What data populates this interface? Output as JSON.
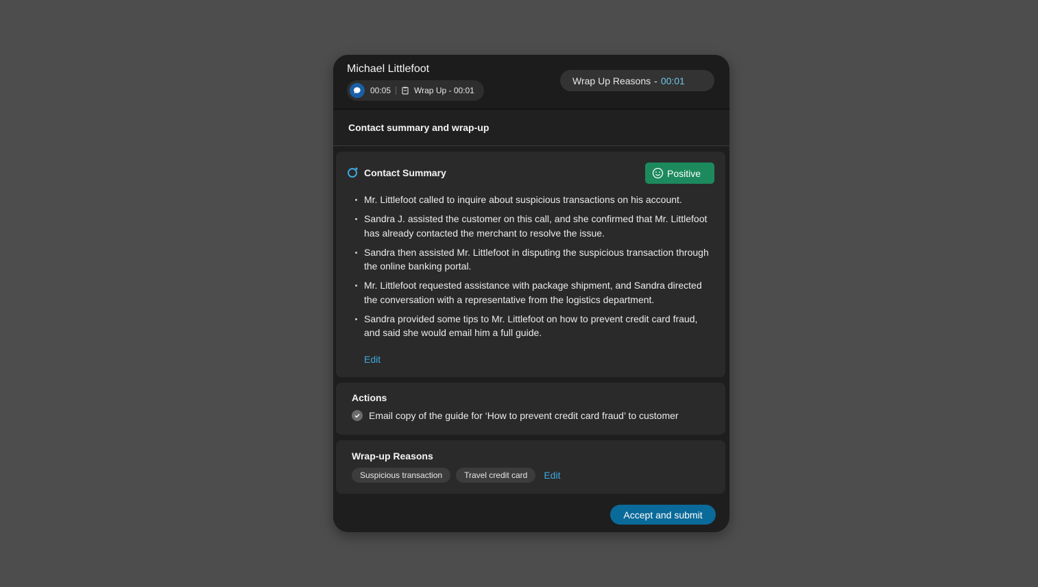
{
  "header": {
    "customer_name": "Michael Littlefoot",
    "call_timer": "00:05",
    "wrap_up_label": "Wrap Up - 00:01",
    "reasons_label": "Wrap Up Reasons",
    "reasons_dash": "-",
    "reasons_timer": "00:01"
  },
  "section": {
    "title": "Contact summary and wrap-up"
  },
  "summary": {
    "title": "Contact Summary",
    "sentiment": "Positive",
    "bullets": [
      "Mr. Littlefoot called to inquire about suspicious transactions on his account.",
      "Sandra J. assisted the customer on this call, and she confirmed that Mr. Littlefoot has already contacted the merchant to resolve the issue.",
      "Sandra then assisted Mr. Littlefoot in disputing the suspicious transaction through the online banking portal.",
      "Mr. Littlefoot requested assistance with package shipment, and Sandra directed the conversation with a representative from the logistics department.",
      "Sandra provided some tips to Mr. Littlefoot on how to prevent credit card fraud, and said she would email him a full guide."
    ],
    "edit_label": "Edit"
  },
  "actions": {
    "title": "Actions",
    "items": [
      "Email copy of the guide for ‘How to prevent credit card fraud’ to customer"
    ]
  },
  "wrapup_reasons": {
    "title": "Wrap-up Reasons",
    "chips": [
      "Suspicious transaction",
      "Travel credit card"
    ],
    "edit_label": "Edit"
  },
  "submit_label": "Accept and submit",
  "icons": {
    "chat": "chat-bubble-icon",
    "wrap_up": "clipboard-icon",
    "summary": "ai-summary-icon",
    "sentiment": "smiley-icon",
    "action_check": "check-circle-icon"
  },
  "colors": {
    "background": "#4d4d4d",
    "panel": "#1e1e1e",
    "card": "#2a2a2a",
    "accent_link": "#3fa9e0",
    "timer_accent": "#6fc6e8",
    "positive_badge": "#1d8a5d",
    "submit_button": "#0a6a99"
  }
}
